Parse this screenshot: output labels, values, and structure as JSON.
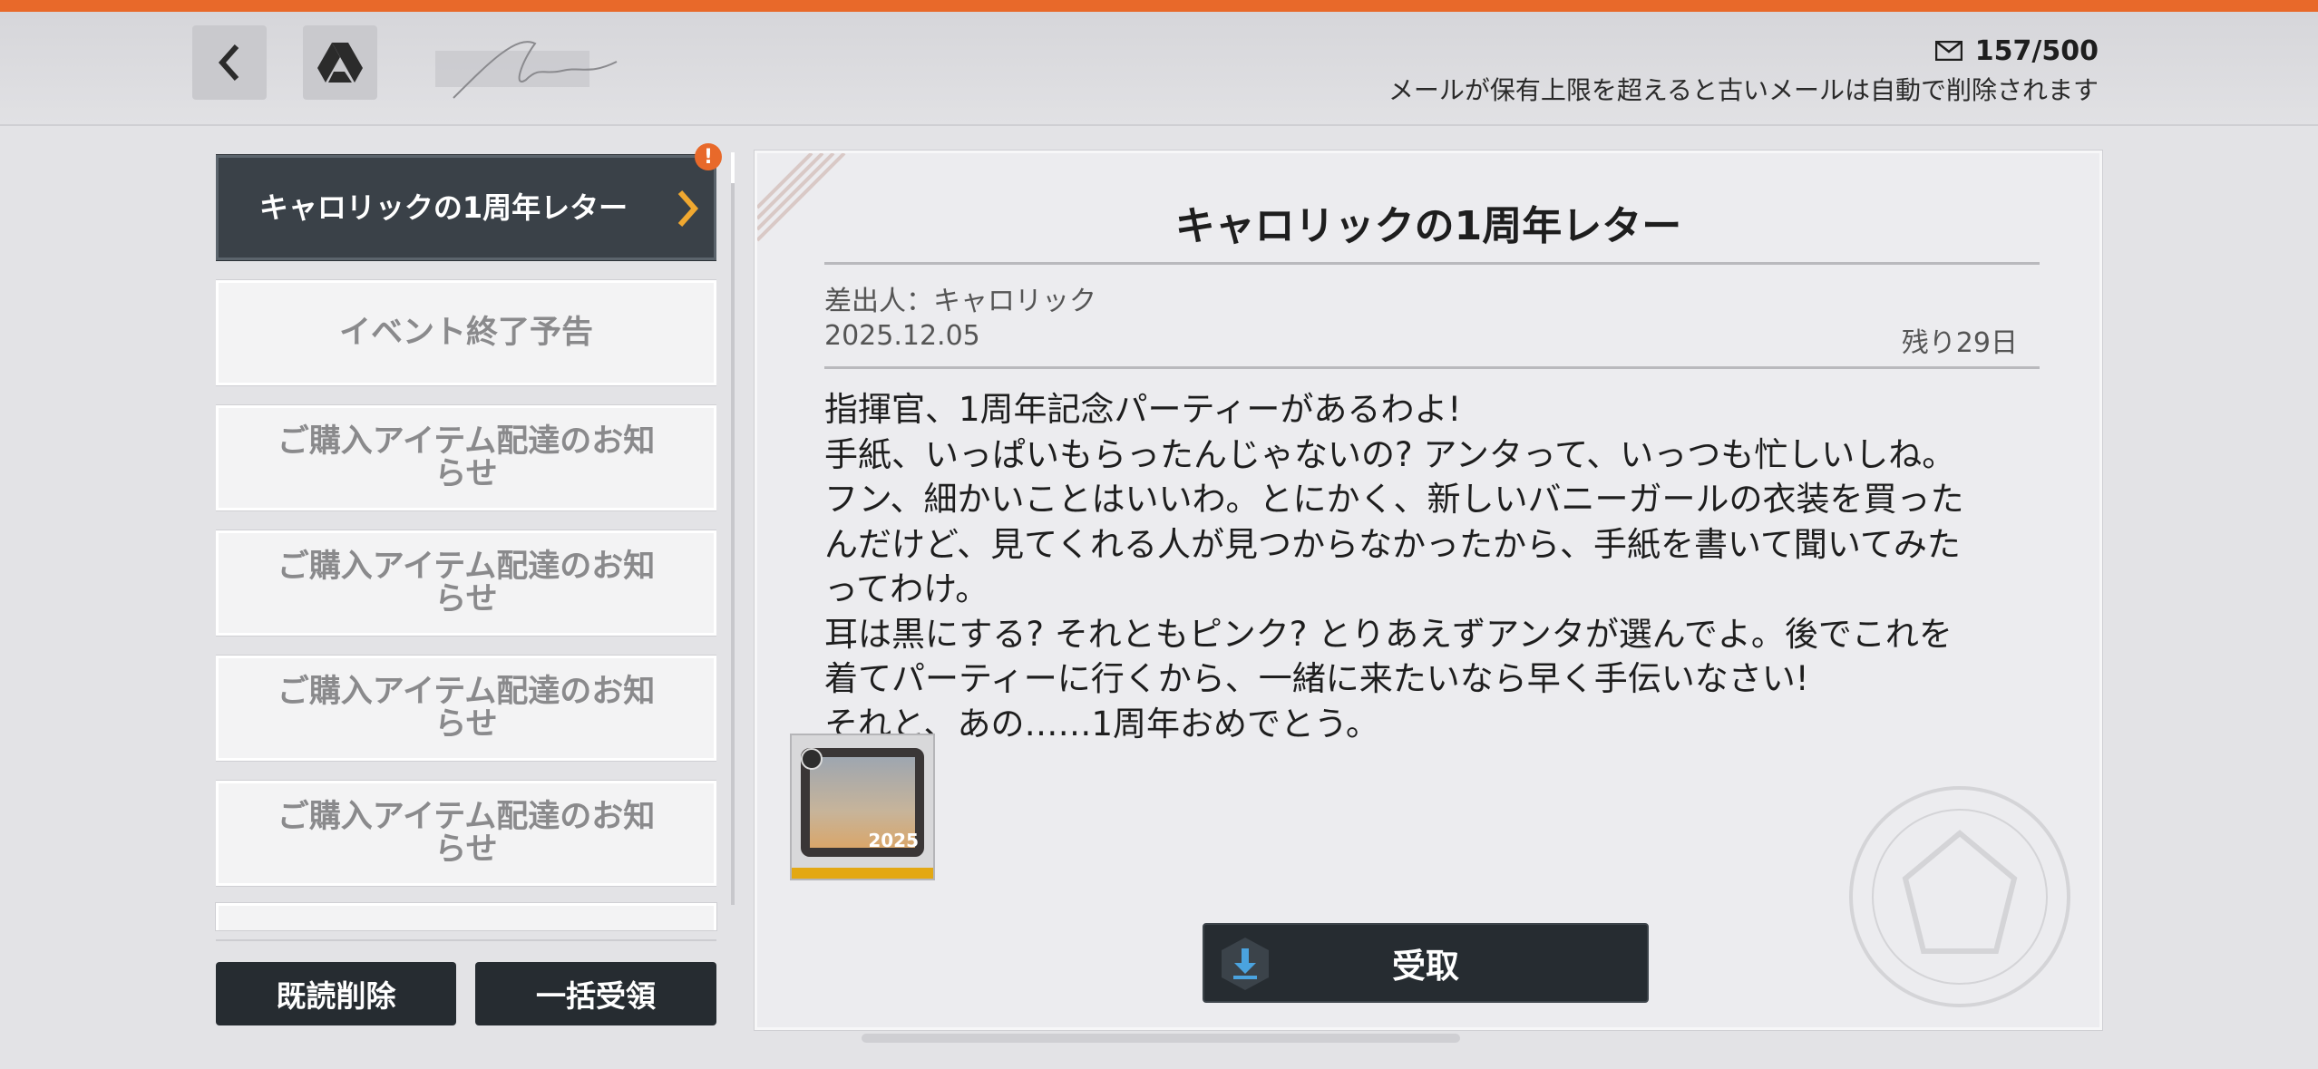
{
  "header": {
    "mail_count": "157/500",
    "mail_note": "メールが保有上限を超えると古いメールは自動で削除されます"
  },
  "mail_list": [
    {
      "title": "キャロリックの1周年レター"
    },
    {
      "title": "イベント終了予告"
    },
    {
      "title": "ご購入アイテム配達のお知らせ"
    },
    {
      "title": "ご購入アイテム配達のお知らせ"
    },
    {
      "title": "ご購入アイテム配達のお知らせ"
    },
    {
      "title": "ご購入アイテム配達のお知らせ"
    }
  ],
  "buttons": {
    "delete_read": "既読削除",
    "claim_all": "一括受領",
    "claim": "受取"
  },
  "letter": {
    "title": "キャロリックの1周年レター",
    "sender": "差出人：キャロリック",
    "date": "2025.12.05",
    "remaining": "残り29日",
    "body_lines": [
      "指揮官、1周年記念パーティーがあるわよ!",
      "手紙、いっぱいもらったんじゃないの? アンタって、いっつも忙しいしね。",
      "フン、細かいことはいいわ。とにかく、新しいバニーガールの衣装を買った",
      "んだけど、見てくれる人が見つからなかったから、手紙を書いて聞いてみた",
      "ってわけ。",
      "耳は黒にする? それともピンク? とりあえずアンタが選んでよ。後でこれを",
      "着てパーティーに行くから、一緒に来たいなら早く手伝いなさい!",
      "それと、あの……1周年おめでとう。"
    ],
    "reward_label": "2025"
  },
  "colors": {
    "accent": "#e8692a",
    "dark_button": "#262c31",
    "active_item": "#3a4148",
    "chevron": "#f0a830",
    "reward_rarity": "#e3a813"
  },
  "icons": [
    "back-icon",
    "drive-icon",
    "mail-icon",
    "chevron-right-icon",
    "alert-icon",
    "download-icon"
  ]
}
